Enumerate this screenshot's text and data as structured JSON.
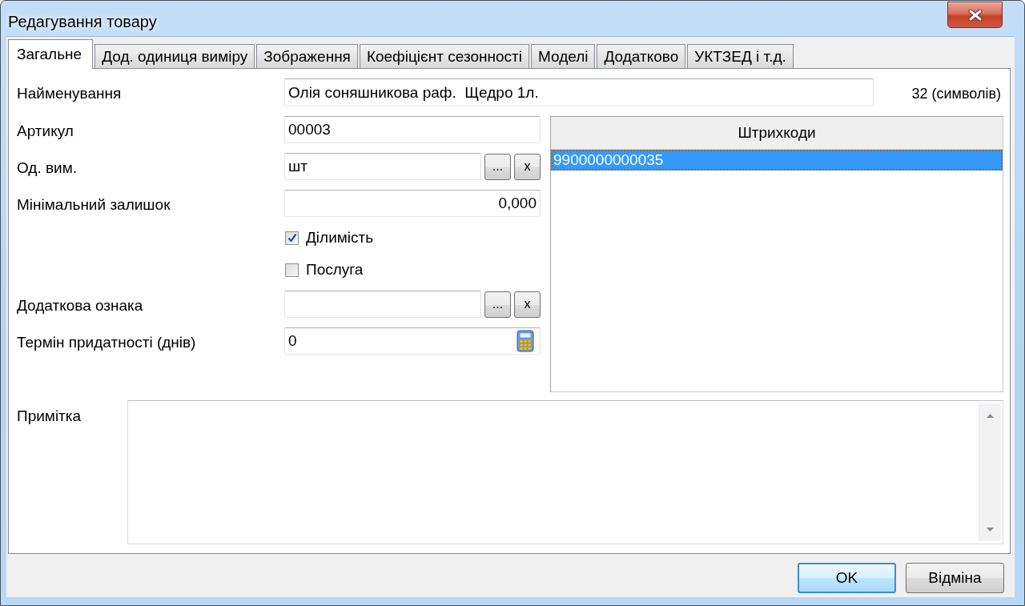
{
  "window": {
    "title": "Редагування товару"
  },
  "tabs": [
    {
      "label": "Загальне",
      "selected": true
    },
    {
      "label": "Дод. одиниця виміру",
      "selected": false
    },
    {
      "label": "Зображення",
      "selected": false
    },
    {
      "label": "Коефіцієнт сезонності",
      "selected": false
    },
    {
      "label": "Моделі",
      "selected": false
    },
    {
      "label": "Додатково",
      "selected": false
    },
    {
      "label": "УКТЗЕД і т.д.",
      "selected": false
    }
  ],
  "name_field": {
    "label": "Найменування",
    "value": "Олія соняшникова раф.  Щедро 1л.",
    "counter": "32 (символів)"
  },
  "fields": [
    {
      "kind": "text",
      "label": "Артикул",
      "value": "00003"
    },
    {
      "kind": "lookup",
      "label": "Од. вим.",
      "value": "шт",
      "buttons": [
        "...",
        "x"
      ]
    },
    {
      "kind": "number",
      "label": "Мінімальний залишок",
      "value": "0,000"
    },
    {
      "kind": "checkbox",
      "label": "Ділимість",
      "checked": true
    },
    {
      "kind": "checkbox",
      "label": "Послуга",
      "checked": false
    },
    {
      "kind": "lookup",
      "label": "Додаткова ознака",
      "buttons": [
        "...",
        "x"
      ]
    },
    {
      "kind": "calculator",
      "label": "Термін придатності (днів)",
      "value": "0"
    }
  ],
  "barcodes": {
    "column": "Штрихкоди",
    "rows": [
      {
        "value": "9900000000035",
        "selected": true
      }
    ]
  },
  "note": {
    "label": "Примітка"
  },
  "buttons": [
    {
      "label": "OK",
      "default": true
    },
    {
      "label": "Відміна",
      "default": false
    }
  ]
}
